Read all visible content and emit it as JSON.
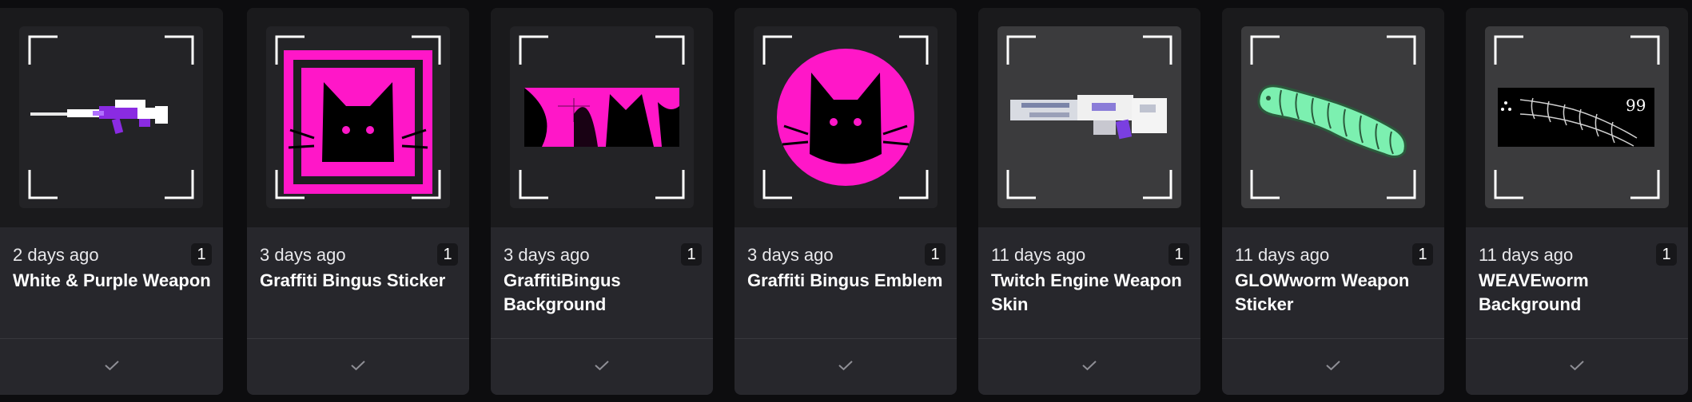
{
  "colors": {
    "background": "#0d0d0f",
    "card": "#27272c",
    "accent_pink": "#ff17c8",
    "accent_purple": "#8a2be2",
    "glow_green": "#7cf0b0"
  },
  "items": [
    {
      "ago": "2 days ago",
      "quantity": "1",
      "name": "White & Purple Weapon",
      "image": "white-purple-rifle-image"
    },
    {
      "ago": "3 days ago",
      "quantity": "1",
      "name": "Graffiti Bingus Sticker",
      "image": "graffiti-bingus-sticker-image"
    },
    {
      "ago": "3 days ago",
      "quantity": "1",
      "name": "GraffitiBingus Background",
      "image": "graffiti-bingus-background-image"
    },
    {
      "ago": "3 days ago",
      "quantity": "1",
      "name": "Graffiti Bingus Emblem",
      "image": "graffiti-bingus-emblem-image"
    },
    {
      "ago": "11 days ago",
      "quantity": "1",
      "name": "Twitch Engine Weapon Skin",
      "image": "twitch-engine-weapon-image"
    },
    {
      "ago": "11 days ago",
      "quantity": "1",
      "name": "GLOWworm Weapon Sticker",
      "image": "glowworm-sticker-image"
    },
    {
      "ago": "11 days ago",
      "quantity": "1",
      "name": "WEAVEworm Background",
      "image": "weaveworm-background-image",
      "badge_text": "99"
    }
  ],
  "icons": {
    "select": "check-icon",
    "frame": "corner-brackets-icon"
  }
}
